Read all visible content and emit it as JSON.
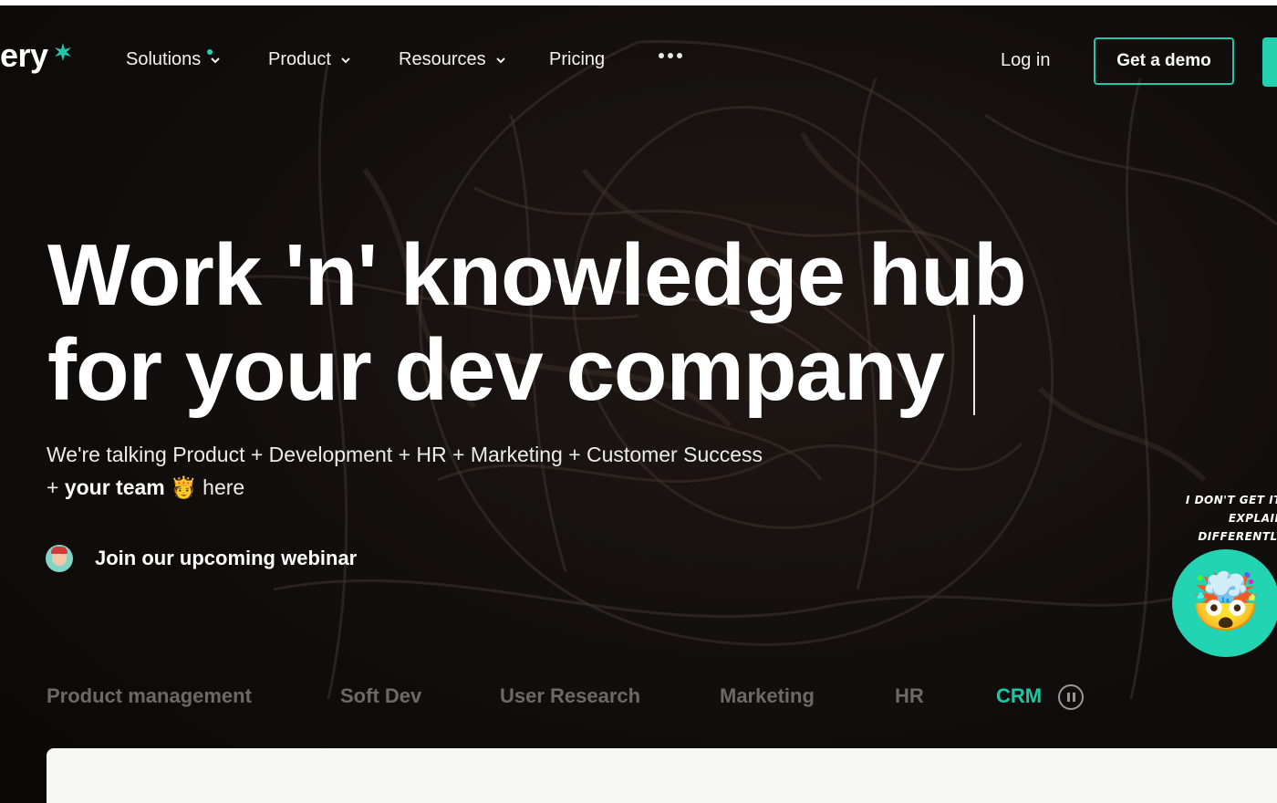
{
  "brand": {
    "wordmark": "ery",
    "accent": "#1ec8a8"
  },
  "nav": {
    "items": [
      {
        "label": "Solutions",
        "has_dropdown": true,
        "has_badge": true
      },
      {
        "label": "Product",
        "has_dropdown": true
      },
      {
        "label": "Resources",
        "has_dropdown": true
      },
      {
        "label": "Pricing",
        "has_dropdown": false
      }
    ],
    "more_icon": "ellipsis-icon",
    "login_label": "Log in",
    "demo_label": "Get a demo"
  },
  "hero": {
    "headline_line1": "Work 'n' knowledge hub",
    "headline_line2": "for your dev company",
    "sub_part1": "We're talking Product + Development + HR + Marketing + Customer Success + ",
    "sub_bold": "your team",
    "sub_emoji": "🫅",
    "sub_part2": " here",
    "webinar_label": "Join our upcoming webinar"
  },
  "helper": {
    "note_line1": "I DON'T GET IT,",
    "note_line2": "EXPLAIN DIFFERENTLY",
    "emoji": "🤯"
  },
  "tabs": {
    "items": [
      {
        "label": "Product management"
      },
      {
        "label": "Soft Dev"
      },
      {
        "label": "User Research"
      },
      {
        "label": "Marketing"
      },
      {
        "label": "HR"
      },
      {
        "label": "CRM",
        "active": true
      }
    ],
    "pause_icon": "pause-icon"
  }
}
